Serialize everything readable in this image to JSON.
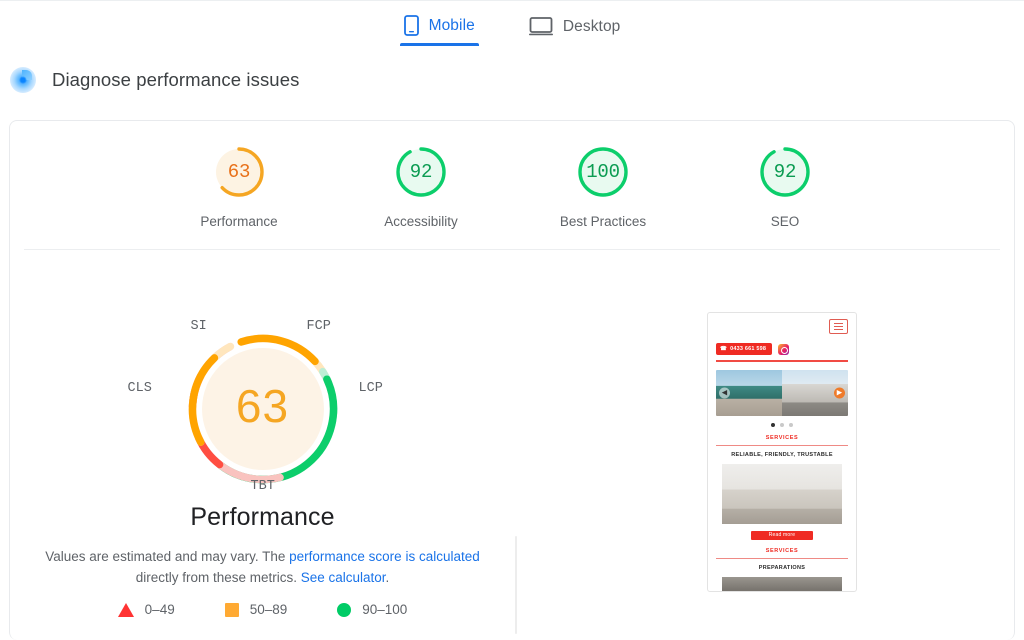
{
  "tabs": [
    {
      "label": "Mobile",
      "icon": "mobile-icon",
      "active": true
    },
    {
      "label": "Desktop",
      "icon": "desktop-icon",
      "active": false
    }
  ],
  "section": {
    "icon": "lighthouse-icon",
    "title": "Diagnose performance issues"
  },
  "scores": [
    {
      "label": "Performance",
      "value": "63",
      "color": "#f5a623",
      "track": "#fdf3e3",
      "text_color": "#e8711a",
      "percent": 63
    },
    {
      "label": "Accessibility",
      "value": "92",
      "color": "#0cce6b",
      "track": "#e8faf0",
      "text_color": "#0b9c52",
      "percent": 92
    },
    {
      "label": "Best Practices",
      "value": "100",
      "color": "#0cce6b",
      "track": "#e8faf0",
      "text_color": "#0b9c52",
      "percent": 100
    },
    {
      "label": "SEO",
      "value": "92",
      "color": "#0cce6b",
      "track": "#e8faf0",
      "text_color": "#0b9c52",
      "percent": 92
    }
  ],
  "performance": {
    "score": "63",
    "title": "Performance",
    "note_pre": "Values are estimated and may vary. The ",
    "note_link1": "performance score is calculated",
    "note_mid": " directly from these metrics. ",
    "note_link2": "See calculator",
    "note_end": "."
  },
  "metrics": [
    {
      "key": "FCP",
      "label": "FCP",
      "fill_color": "#ff4e42",
      "track_color": "#f9c3bf"
    },
    {
      "key": "LCP",
      "label": "LCP",
      "fill_color": "#ffa400",
      "track_color": "#ffe6bd"
    },
    {
      "key": "TBT",
      "label": "TBT",
      "fill_color": "#0cce6b",
      "track_color": "#bdeed5"
    },
    {
      "key": "CLS",
      "label": "CLS",
      "fill_color": "#ff4e42",
      "track_color": "#f9c3bf"
    },
    {
      "key": "SI",
      "label": "SI",
      "fill_color": "#ffa400",
      "track_color": "#ffe6bd"
    }
  ],
  "legend": [
    {
      "shape": "triangle",
      "color": "#ff3333",
      "label": "0–49"
    },
    {
      "shape": "square",
      "color": "#ffaa33",
      "label": "50–89"
    },
    {
      "shape": "circle",
      "color": "#00cc66",
      "label": "90–100"
    }
  ],
  "screenshot": {
    "alt": "mobile-page-screenshot",
    "phone_button": "0433 661 598",
    "services_1": "SERVICES",
    "tagline": "RELIABLE, FRIENDLY, TRUSTABLE",
    "read_more": "Read more",
    "services_2": "SERVICES",
    "preparations": "PREPARATIONS"
  }
}
